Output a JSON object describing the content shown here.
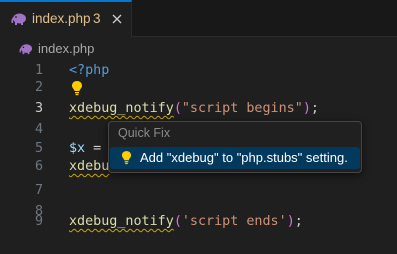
{
  "tab": {
    "filename": "index.php",
    "problem_count": "3",
    "icon": "php-elephant-icon",
    "close_icon": "close-icon",
    "modified_color": "#e2c08d"
  },
  "breadcrumb": {
    "filename": "index.php",
    "icon": "php-elephant-icon"
  },
  "editor": {
    "lines": [
      {
        "number": "1",
        "tokens": {
          "open_tag": "<?php"
        }
      },
      {
        "number": "2",
        "lightbulb": "lightbulb-icon"
      },
      {
        "number": "3",
        "tokens": {
          "fn": "xdebug_notify",
          "open": "(",
          "str": "\"script begins\"",
          "close": ")",
          "semi": ";"
        }
      },
      {
        "number": "4"
      },
      {
        "number": "5",
        "tokens": {
          "var": "$x",
          "op": " ="
        }
      },
      {
        "number": "6",
        "tokens": {
          "fn_visible": "xdebu",
          "tail": "   ;"
        }
      },
      {
        "number": "7"
      },
      {
        "number": "8"
      },
      {
        "number": "9",
        "tokens": {
          "fn": "xdebug_notify",
          "open": "(",
          "str": "'script ends'",
          "close": ")",
          "semi": ";"
        }
      }
    ],
    "active_line": "3",
    "warning_squiggle_color": "#cca700"
  },
  "quick_fix": {
    "title": "Quick Fix",
    "items": [
      {
        "icon": "lightbulb-icon",
        "label": "Add \"xdebug\" to \"php.stubs\" setting."
      }
    ],
    "selected_color": "#04395e"
  }
}
